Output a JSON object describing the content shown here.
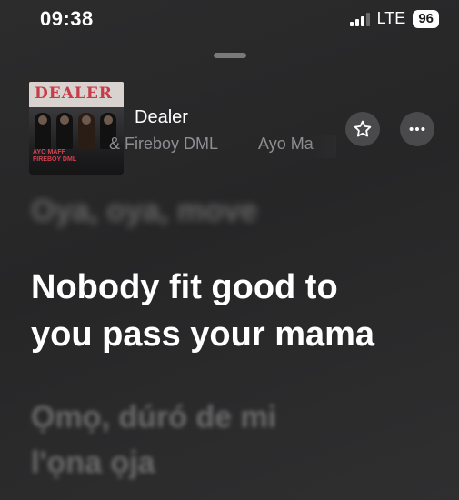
{
  "status_bar": {
    "time": "09:38",
    "network": "LTE",
    "battery": "96",
    "signal_bars_filled": 3,
    "signal_bars_total": 4
  },
  "album_art": {
    "logo_text": "DEALER",
    "artists_text": [
      "AYO MAFF",
      "FIREBOY DML"
    ]
  },
  "track": {
    "title": "Dealer",
    "artist_1": "& Fireboy DML",
    "artist_2": "Ayo Ma"
  },
  "buttons": {
    "favorite_icon": "star-icon",
    "more_icon": "ellipsis-icon"
  },
  "lyrics": {
    "previous": "Oya, oya, move",
    "current": [
      "Nobody fit good to",
      "you pass your mama"
    ],
    "next": [
      "Ọmọ, dúró de mi",
      "l'ọna ọja"
    ]
  },
  "colors": {
    "background": "#2a2a2b",
    "secondary_text": "#8e8e93",
    "button_fill": "#4a4a4c",
    "album_logo": "#c83b4a"
  }
}
